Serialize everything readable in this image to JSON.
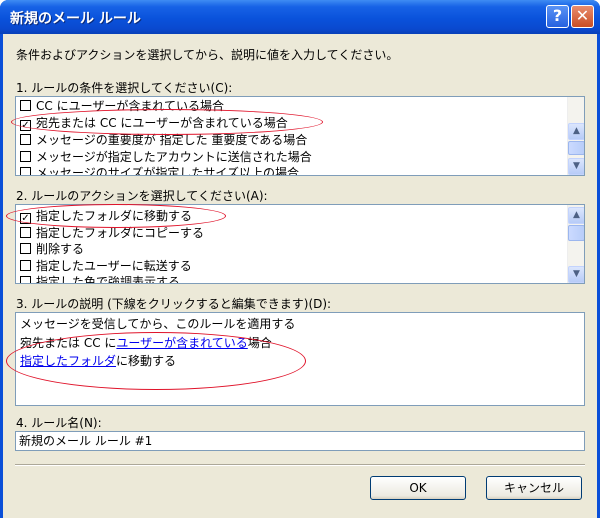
{
  "window": {
    "title": "新規のメール ルール",
    "help_glyph": "?",
    "close_glyph": "✕"
  },
  "instruction": "条件およびアクションを選択してから、説明に値を入力してください。",
  "section1": {
    "label": "1. ルールの条件を選択してください(C):",
    "items": [
      {
        "label": "CC にユーザーが含まれている場合",
        "checked": false
      },
      {
        "label": "宛先または CC にユーザーが含まれている場合",
        "checked": true
      },
      {
        "label": "メッセージの重要度が 指定した 重要度である場合",
        "checked": false
      },
      {
        "label": "メッセージが指定したアカウントに送信された場合",
        "checked": false
      },
      {
        "label": "メッセージのサイズが指定したサイズ以上の場合",
        "checked": false
      }
    ]
  },
  "section2": {
    "label": "2. ルールのアクションを選択してください(A):",
    "items": [
      {
        "label": "指定したフォルダに移動する",
        "checked": true
      },
      {
        "label": "指定したフォルダにコピーする",
        "checked": false
      },
      {
        "label": "削除する",
        "checked": false
      },
      {
        "label": "指定したユーザーに転送する",
        "checked": false
      },
      {
        "label": "指定した色で強調表示する",
        "checked": false
      }
    ]
  },
  "section3": {
    "label": "3. ルールの説明 (下線をクリックすると編集できます)(D):",
    "line1": "メッセージを受信してから、このルールを適用する",
    "line2_prefix": "宛先または CC に",
    "line2_link": "ユーザーが含まれている",
    "line2_suffix": "場合",
    "line3_link": "指定したフォルダ",
    "line3_suffix": "に移動する"
  },
  "section4": {
    "label": "4. ルール名(N):",
    "value": "新規のメール ルール #1"
  },
  "buttons": {
    "ok": "OK",
    "cancel": "キャンセル"
  },
  "icons": {
    "check": "✓",
    "scroll_up": "▲",
    "scroll_down": "▼"
  },
  "colors": {
    "titlebar": "#0a52db",
    "dialog_bg": "#ece9d8",
    "link": "#0000ee",
    "highlight_ellipse": "#e0132a"
  }
}
